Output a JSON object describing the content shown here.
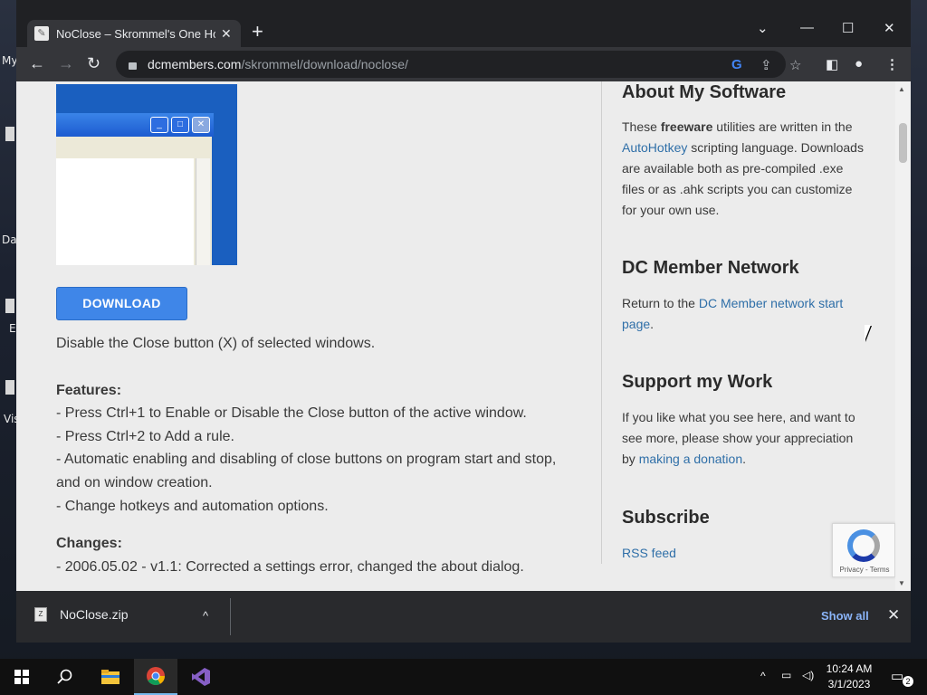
{
  "desktop": {
    "labels": [
      "My",
      "Da",
      "E",
      "Vis"
    ]
  },
  "browser": {
    "tab": {
      "title": "NoClose – Skrommel's One Hour",
      "close": "✕"
    },
    "new_tab": "+",
    "window_controls": {
      "tab_search": "⌄",
      "minimize": "—",
      "maximize": "☐",
      "close": "✕"
    },
    "nav": {
      "back": "←",
      "forward": "→",
      "reload": "↻"
    },
    "url": {
      "host": "dcmembers.com",
      "path": "/skrommel/download/noclose/"
    },
    "omnibox_icons": {
      "google": "G",
      "share": "⇪",
      "bookmark": "☆"
    },
    "toolbar_icons": {
      "sidepanel": "◧",
      "profile": "●",
      "menu": "⋮"
    }
  },
  "page": {
    "download_button": "DOWNLOAD",
    "description": "Disable the Close button (X) of selected windows.",
    "features_heading": "Features:",
    "features": [
      "- Press Ctrl+1 to Enable or Disable the Close button of the active window.",
      "- Press Ctrl+2 to Add a rule.",
      "- Automatic enabling and disabling of close buttons on program start and stop, and on window creation.",
      "- Change hotkeys and automation options."
    ],
    "changes_heading": "Changes:",
    "changes": [
      "- 2006.05.02 - v1.1: Corrected a settings error, changed the about dialog."
    ]
  },
  "sidebar": {
    "about": {
      "heading": "About My Software",
      "text_1": "These ",
      "bold": "freeware",
      "text_2": " utilities are written in the ",
      "link": "AutoHotkey",
      "text_3": " scripting language. Downloads are available both as pre-compiled .exe files or as .ahk scripts you can customize for your own use."
    },
    "network": {
      "heading": "DC Member Network",
      "text_1": "Return to the ",
      "link": "DC Member network start page",
      "text_2": "."
    },
    "support": {
      "heading": "Support my Work",
      "text_1": "If you like what you see here, and want to see more, please show your appreciation by ",
      "link": "making a donation",
      "text_2": "."
    },
    "subscribe": {
      "heading": "Subscribe",
      "link": "RSS feed"
    },
    "recaptcha": "Privacy - Terms"
  },
  "download_shelf": {
    "file_name": "NoClose.zip",
    "caret": "^",
    "show_all": "Show all",
    "close": "✕"
  },
  "taskbar": {
    "time": "10:24 AM",
    "date": "3/1/2023",
    "notification_count": "2"
  },
  "colors": {
    "link": "#2f6fa8",
    "download_button": "#3f86e8",
    "chrome_dark": "#202124"
  }
}
